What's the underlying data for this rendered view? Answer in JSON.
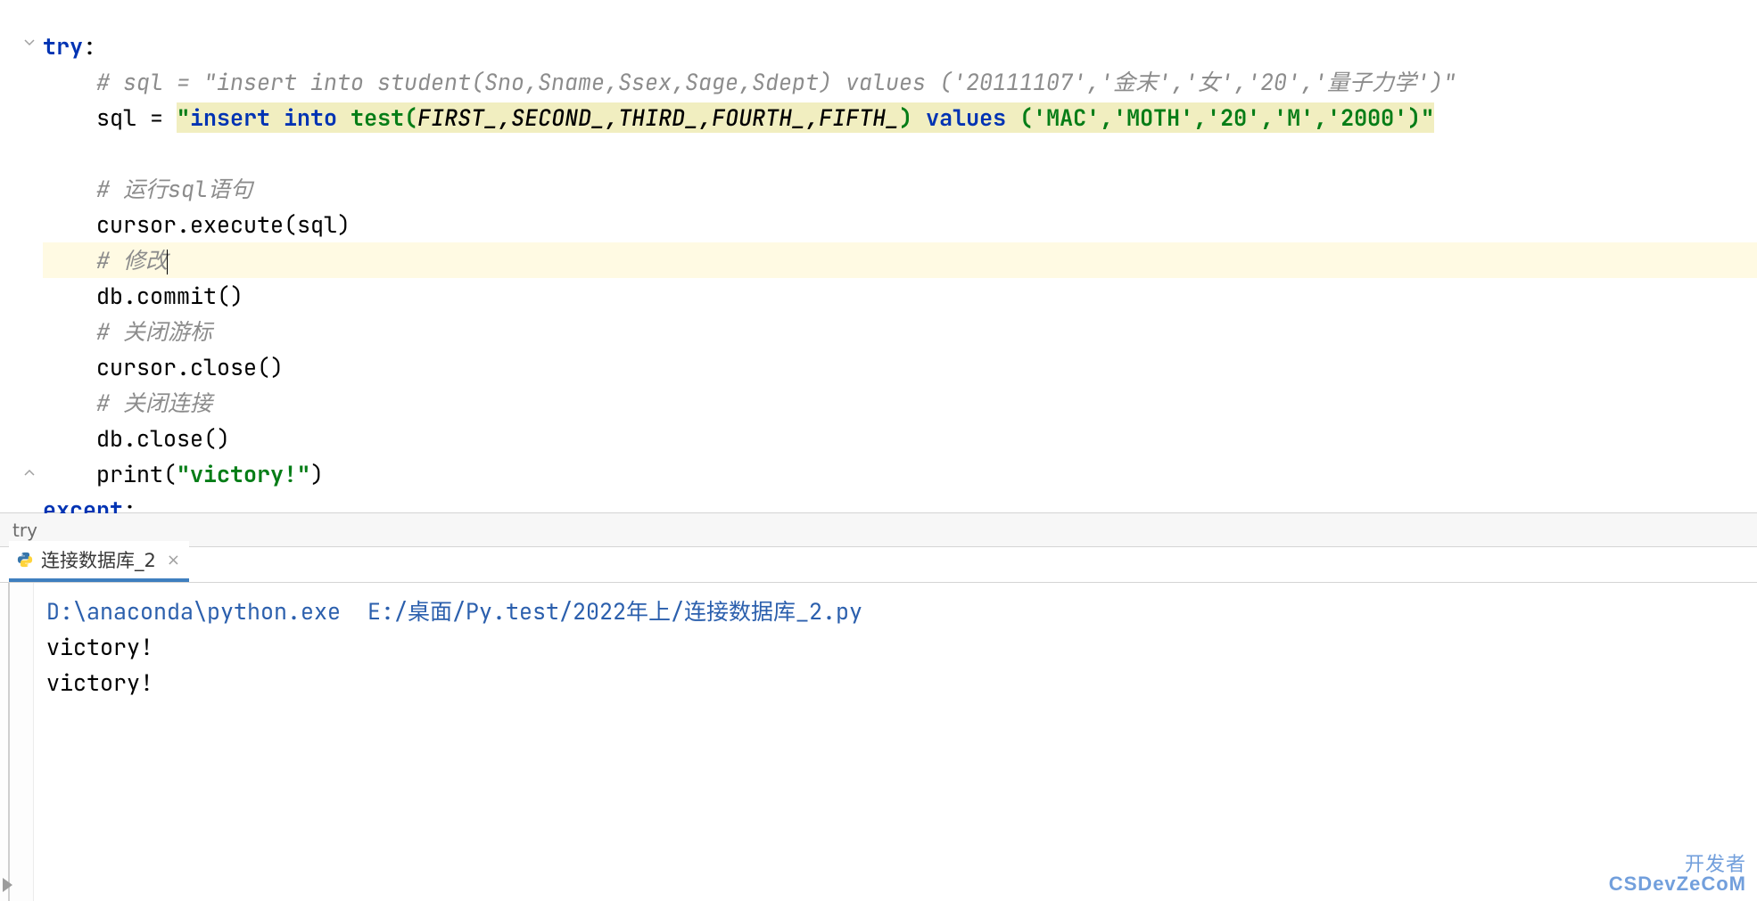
{
  "code": {
    "try_kw": "try",
    "colon": ":",
    "comment_sql_old": "# sql = \"insert into student(Sno,Sname,Ssex,Sage,Sdept) values ('20111107','金末','女','20','量子力学')\"",
    "assign_lhs": "sql = ",
    "sql_quote": "\"",
    "sql_kw_insert": "insert into",
    "sql_call": " test",
    "sql_paren_open": "(",
    "sql_cols": "FIRST_,SECOND_,THIRD_,FOURTH_,FIFTH_",
    "sql_paren_close": ")",
    "sql_kw_values": " values ",
    "sql_vals": "('MAC','MOTH','20','M','2000')",
    "comment_run": "# 运行sql语句",
    "exec_line": "cursor.execute(sql)",
    "comment_modify": "# 修改",
    "commit_line": "db.commit()",
    "comment_closecur": "# 关闭游标",
    "closecur_line": "cursor.close()",
    "comment_closeconn": "# 关闭连接",
    "closeconn_line": "db.close()",
    "print_call": "print(",
    "print_str": "\"victory!\"",
    "print_close": ")",
    "except_kw": "except",
    "except_colon": ":"
  },
  "breadcrumb": {
    "label": "try"
  },
  "run_tab": {
    "label": "连接数据库_2"
  },
  "console": {
    "cmd": "D:\\anaconda\\python.exe  E:/桌面/Py.test/2022年上/连接数据库_2.py",
    "out1": "victory!",
    "out2": "victory!"
  },
  "watermark": {
    "top": "开发者",
    "bot": "CSDevZeCoM"
  }
}
